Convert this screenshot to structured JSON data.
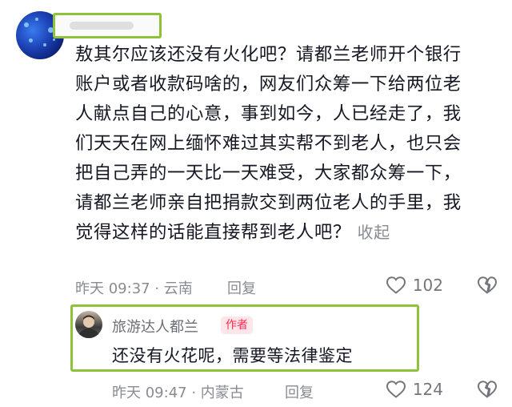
{
  "comment": {
    "username": "",
    "text": "敖其尔应该还没有火化吧？请都兰老师开个银行\n账户或者收款码啥的，网友们众筹一下给两位老\n人献点自己的心意，事到如今，人已经走了，我\n们天天在网上缅怀难过其实帮不到老人，也只会\n把自己弄的一天比一天难受，大家都众筹一下，\n请都兰老师亲自把捐款交到两位老人的手里，我\n觉得这样的话能直接帮到老人吧？",
    "collapse_label": "收起",
    "time_location": "昨天 09:37 · 云南",
    "reply_label": "回复",
    "like_count": "102"
  },
  "reply": {
    "username": "旅游达人都兰",
    "badge": "作者",
    "text": "还没有火花呢，需要等法律鉴定",
    "time_location": "昨天 09:47 · 内蒙古",
    "reply_label": "回复",
    "like_count": "124"
  },
  "colors": {
    "highlight_border": "#8ec23a",
    "badge_text": "#fe2c55",
    "meta_gray": "#8a8b91"
  },
  "icons": {
    "like": "heart-outline-icon",
    "dislike": "broken-heart-icon"
  }
}
